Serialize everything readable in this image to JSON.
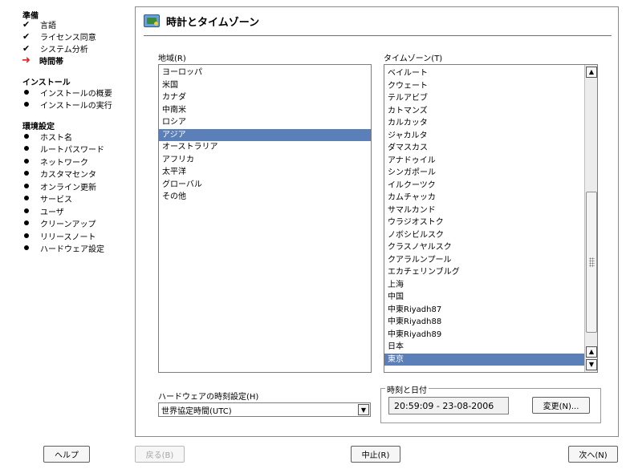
{
  "sidebar": {
    "sections": [
      {
        "title": "準備",
        "steps": [
          {
            "label": "言語",
            "status": "done"
          },
          {
            "label": "ライセンス同意",
            "status": "done"
          },
          {
            "label": "システム分析",
            "status": "done"
          },
          {
            "label": "時間帯",
            "status": "current"
          }
        ]
      },
      {
        "title": "インストール",
        "steps": [
          {
            "label": "インストールの概要",
            "status": "pending"
          },
          {
            "label": "インストールの実行",
            "status": "pending"
          }
        ]
      },
      {
        "title": "環境設定",
        "steps": [
          {
            "label": "ホスト名",
            "status": "pending"
          },
          {
            "label": "ルートパスワード",
            "status": "pending"
          },
          {
            "label": "ネットワーク",
            "status": "pending"
          },
          {
            "label": "カスタマセンタ",
            "status": "pending"
          },
          {
            "label": "オンライン更新",
            "status": "pending"
          },
          {
            "label": "サービス",
            "status": "pending"
          },
          {
            "label": "ユーザ",
            "status": "pending"
          },
          {
            "label": "クリーンアップ",
            "status": "pending"
          },
          {
            "label": "リリースノート",
            "status": "pending"
          },
          {
            "label": "ハードウェア設定",
            "status": "pending"
          }
        ]
      }
    ]
  },
  "main": {
    "title": "時計とタイムゾーン",
    "region": {
      "label": "地域(R)",
      "items": [
        "ヨーロッパ",
        "米国",
        "カナダ",
        "中南米",
        "ロシア",
        "アジア",
        "オーストラリア",
        "アフリカ",
        "太平洋",
        "グローバル",
        "その他"
      ],
      "selected": "アジア"
    },
    "timezone": {
      "label": "タイムゾーン(T)",
      "items": [
        "ベイルート",
        "クウェート",
        "テルアビブ",
        "カトマンズ",
        "カルカッタ",
        "ジャカルタ",
        "ダマスカス",
        "アナドゥイル",
        "シンガポール",
        "イルクーツク",
        "カムチャッカ",
        "サマルカンド",
        "ウラジオストク",
        "ノボシビルスク",
        "クラスノヤルスク",
        "クアラルンプール",
        "エカチェリンブルグ",
        "上海",
        "中国",
        "中東Riyadh87",
        "中東Riyadh88",
        "中東Riyadh89",
        "日本",
        "東京"
      ],
      "selected": "東京"
    },
    "hardware_clock": {
      "label": "ハードウェアの時刻設定(H)",
      "value": "世界協定時間(UTC)"
    },
    "datetime": {
      "group_label": "時刻と日付",
      "value": "20:59:09 - 23-08-2006",
      "change_label": "変更(N)..."
    }
  },
  "buttons": {
    "help": "ヘルプ",
    "back": "戻る(B)",
    "abort": "中止(R)",
    "next": "次へ(N)"
  },
  "colors": {
    "selection": "#5b7fb8",
    "current_arrow": "#e02020"
  }
}
